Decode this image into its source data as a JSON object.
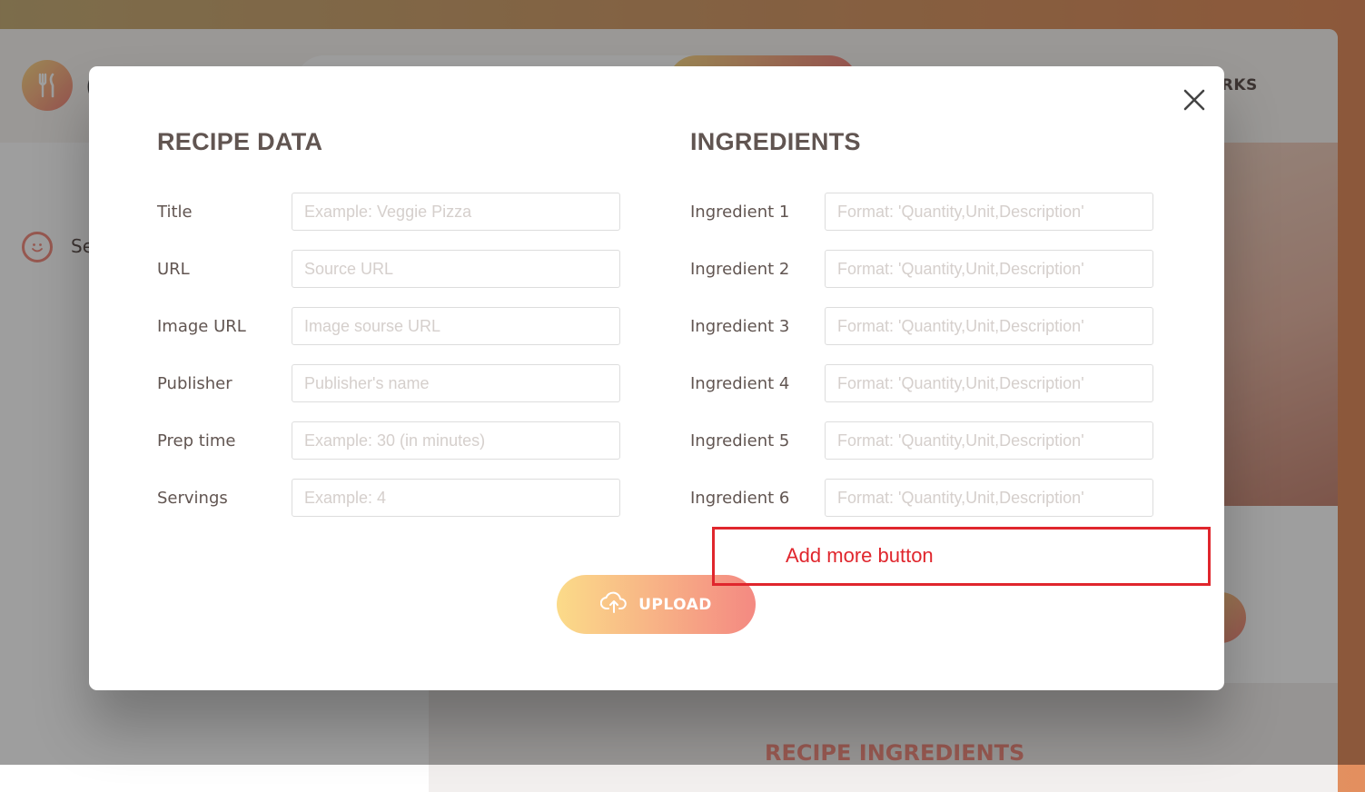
{
  "app": {
    "logo_letter": "(",
    "nav_bookmarks": "KMARKS",
    "sidebar_message": "Se",
    "ingredients_title": "RECIPE INGREDIENTS"
  },
  "modal": {
    "recipe_heading": "RECIPE DATA",
    "ingredients_heading": "INGREDIENTS",
    "recipe_fields": [
      {
        "label": "Title",
        "placeholder": "Example: Veggie Pizza"
      },
      {
        "label": "URL",
        "placeholder": "Source URL"
      },
      {
        "label": "Image URL",
        "placeholder": "Image sourse URL"
      },
      {
        "label": "Publisher",
        "placeholder": "Publisher's name"
      },
      {
        "label": "Prep time",
        "placeholder": "Example: 30 (in minutes)"
      },
      {
        "label": "Servings",
        "placeholder": "Example: 4"
      }
    ],
    "ingredient_fields": [
      {
        "label": "Ingredient 1",
        "placeholder": "Format: 'Quantity,Unit,Description'"
      },
      {
        "label": "Ingredient 2",
        "placeholder": "Format: 'Quantity,Unit,Description'"
      },
      {
        "label": "Ingredient 3",
        "placeholder": "Format: 'Quantity,Unit,Description'"
      },
      {
        "label": "Ingredient 4",
        "placeholder": "Format: 'Quantity,Unit,Description'"
      },
      {
        "label": "Ingredient 5",
        "placeholder": "Format: 'Quantity,Unit,Description'"
      },
      {
        "label": "Ingredient 6",
        "placeholder": "Format: 'Quantity,Unit,Description'"
      }
    ],
    "upload_label": "UPLOAD"
  },
  "annotation": {
    "text": "Add more button",
    "color": "#e0262d"
  },
  "colors": {
    "accent_start": "#fbdb89",
    "accent_end": "#f48982",
    "text": "#615551"
  },
  "icons": {
    "logo": "fork-knife-icon",
    "close": "close-icon",
    "upload": "cloud-upload-icon",
    "sidebar": "smiley-icon"
  }
}
